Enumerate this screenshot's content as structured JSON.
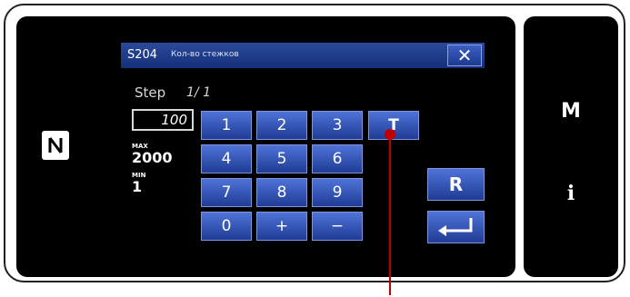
{
  "dialog": {
    "code": "S204",
    "title": "Кол-во стежков",
    "close_label": "✕"
  },
  "step": {
    "label": "Step",
    "value": "1/ 1"
  },
  "input": {
    "value": "100"
  },
  "range": {
    "max_label": "MAX",
    "max_value": "2000",
    "min_label": "MIN",
    "min_value": "1"
  },
  "keypad": {
    "k1": "1",
    "k2": "2",
    "k3": "3",
    "kT": "T",
    "k4": "4",
    "k5": "5",
    "k6": "6",
    "k7": "7",
    "k8": "8",
    "k9": "9",
    "k0": "0",
    "kplus": "+",
    "kminus": "−"
  },
  "side_keys": {
    "reset": "R",
    "enter": "↵"
  },
  "side_panel": {
    "mode": "M",
    "info": "i"
  },
  "colors": {
    "key_top": "#4f73d8",
    "key_bottom": "#1f3c95",
    "callout": "#c00000"
  },
  "icons": [
    "nfc-icon",
    "close-icon",
    "enter-icon"
  ]
}
